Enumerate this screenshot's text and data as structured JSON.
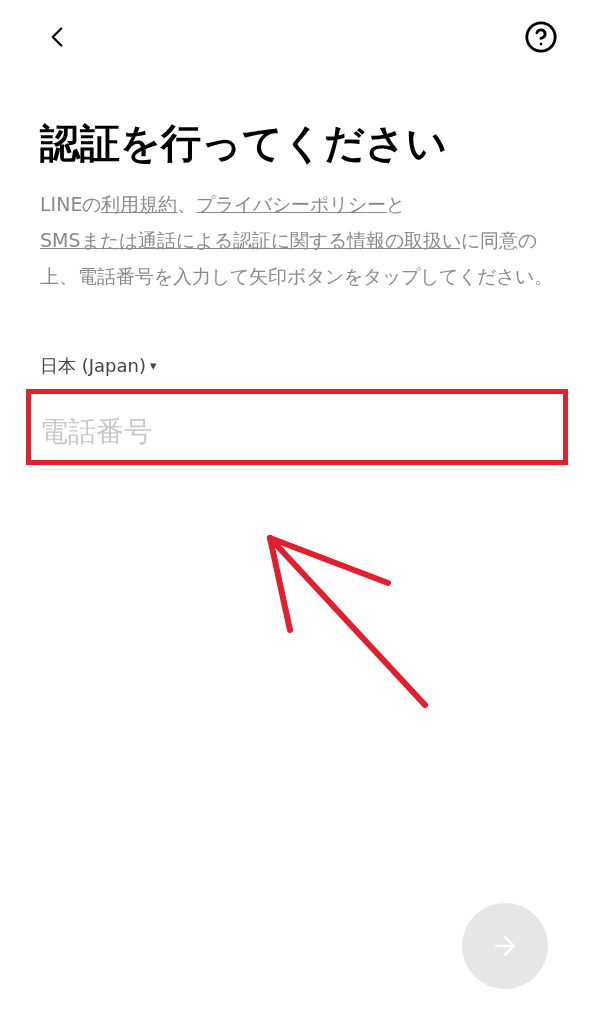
{
  "title": "認証を行ってください",
  "notice": [
    {
      "text": "LINEの",
      "link": false
    },
    {
      "text": "利用規約",
      "link": true
    },
    {
      "text": "、",
      "link": false
    },
    {
      "text": "プライバシーポリシー",
      "link": true
    },
    {
      "text": "と",
      "link": false
    },
    {
      "text": "SMSまたは通話による認証に関する情報の取扱い",
      "link": true
    },
    {
      "text": "に同意の上、電話番号を入力して矢印ボタンをタップしてください。",
      "link": false
    }
  ],
  "country": {
    "label": "日本 (Japan)",
    "caret": "▾"
  },
  "phone_field": {
    "placeholder": "電話番号",
    "highlighted": true
  },
  "next_button": {
    "disabled": true
  }
}
